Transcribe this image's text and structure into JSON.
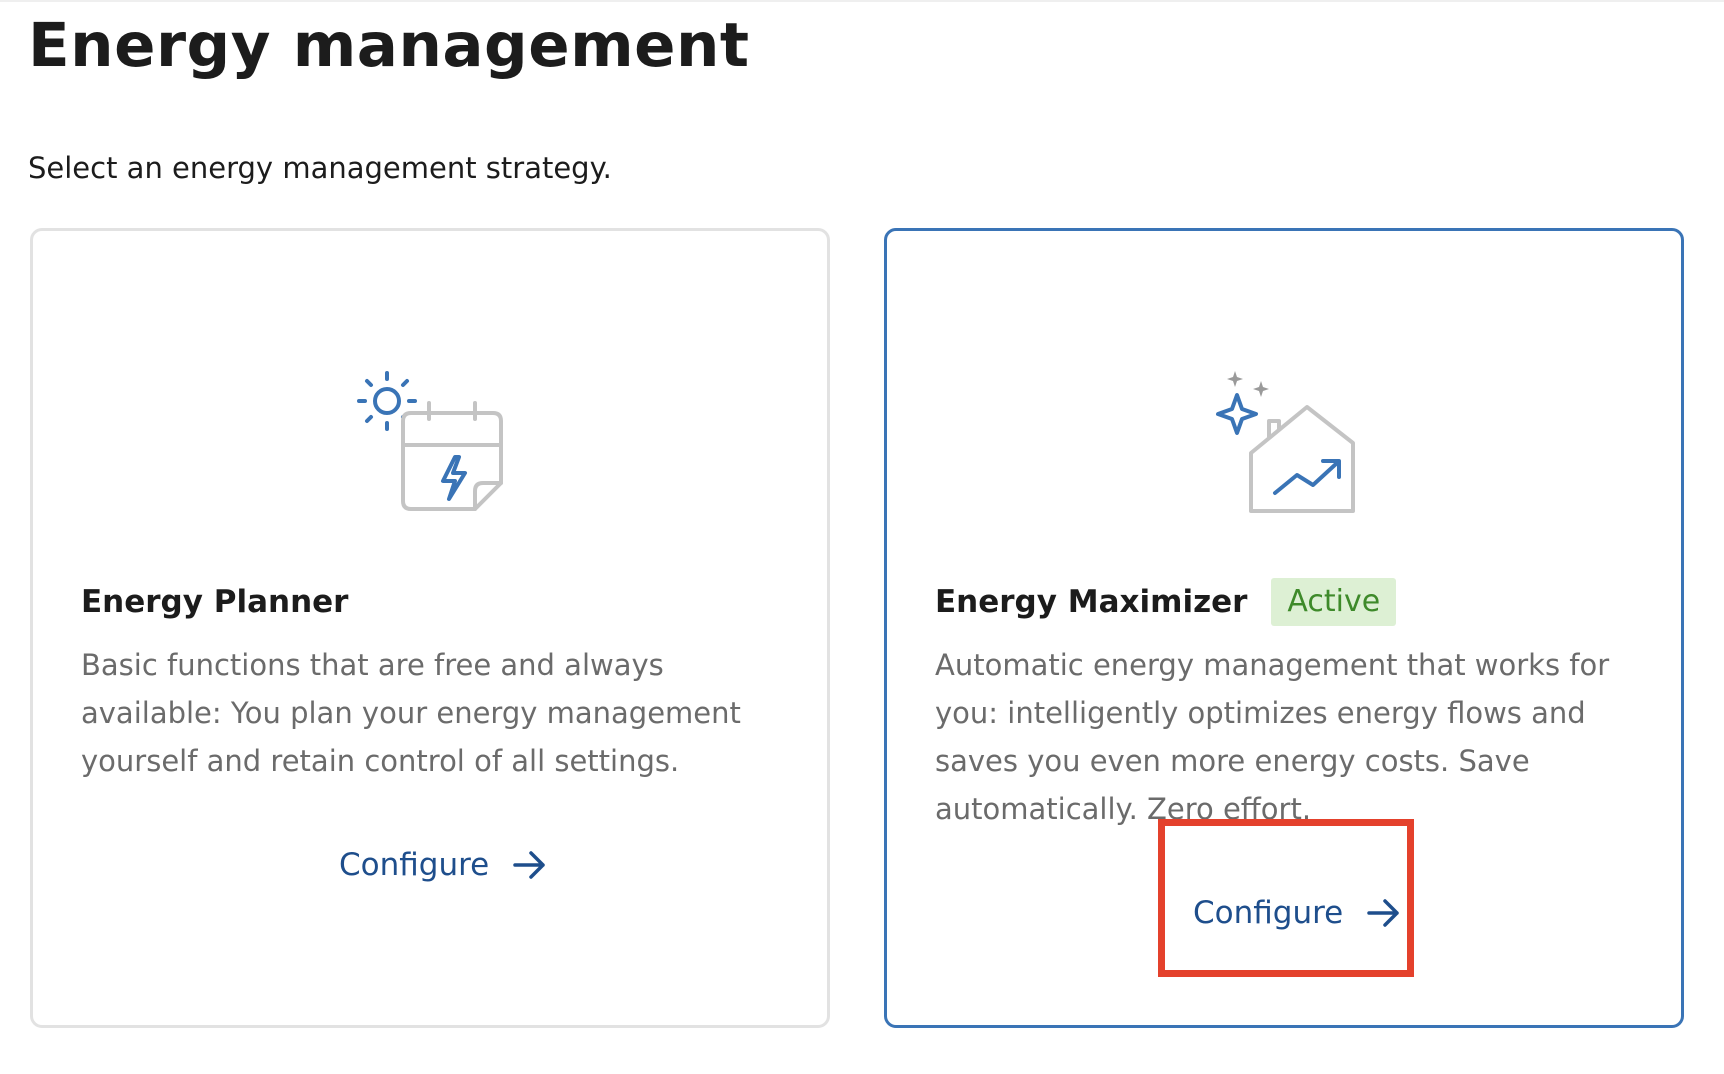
{
  "page": {
    "title": "Energy management",
    "subtitle": "Select an energy management strategy."
  },
  "cards": [
    {
      "id": "planner",
      "title": "Energy Planner",
      "badge": "",
      "selected": false,
      "description": "Basic functions that are free and always available: You plan your energy management yourself and retain control of all settings.",
      "action_label": "Configure",
      "icon": "sun-calendar-bolt-icon"
    },
    {
      "id": "maximizer",
      "title": "Energy Maximizer",
      "badge": "Active",
      "selected": true,
      "description": "Automatic energy management that works for you: intelligently optimizes energy flows and saves you even more energy costs. Save automatically. Zero effort.",
      "action_label": "Configure",
      "icon": "house-sparkle-trend-icon"
    }
  ],
  "colors": {
    "accent_blue": "#3a74b6",
    "link_blue": "#1e4e8c",
    "badge_bg": "#ddf0d4",
    "badge_text": "#3e8a2a",
    "highlight_red": "#e4412c",
    "icon_gray": "#c4c4c4"
  }
}
